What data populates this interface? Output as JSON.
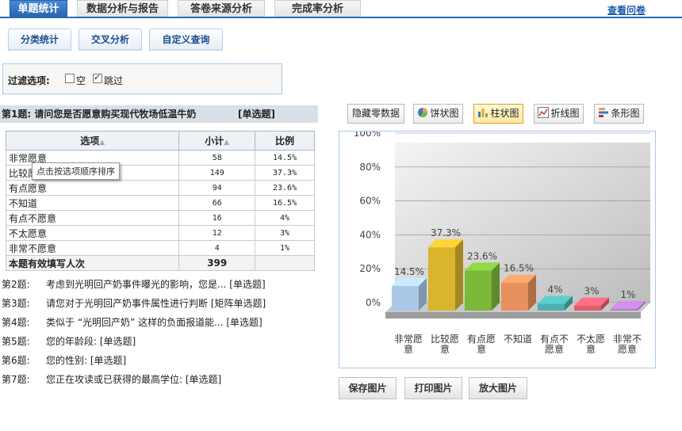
{
  "top_tabs": [
    {
      "label": "单题统计",
      "active": true
    },
    {
      "label": "数据分析与报告",
      "active": false
    },
    {
      "label": "答卷来源分析",
      "active": false
    },
    {
      "label": "完成率分析",
      "active": false
    }
  ],
  "view_link": "查看问卷",
  "sub_tabs": [
    "分类统计",
    "交叉分析",
    "自定义查询"
  ],
  "filter": {
    "label": "过滤选项:",
    "options": [
      {
        "label": "空",
        "checked": false
      },
      {
        "label": "跳过",
        "checked": true
      }
    ]
  },
  "question": {
    "title": "第1题:   请问您是否愿意购买现代牧场低温牛奶",
    "type": "[单选题]"
  },
  "table": {
    "headers": [
      "选项",
      "小计",
      "比例"
    ],
    "rows": [
      {
        "option": "非常愿意",
        "count": "58",
        "ratio": "14.5%"
      },
      {
        "option": "比较愿意",
        "count": "149",
        "ratio": "37.3%"
      },
      {
        "option": "有点愿意",
        "count": "94",
        "ratio": "23.6%"
      },
      {
        "option": "不知道",
        "count": "66",
        "ratio": "16.5%"
      },
      {
        "option": "有点不愿意",
        "count": "16",
        "ratio": "4%"
      },
      {
        "option": "不太愿意",
        "count": "12",
        "ratio": "3%"
      },
      {
        "option": "非常不愿意",
        "count": "4",
        "ratio": "1%"
      }
    ],
    "total_label": "本题有效填写人次",
    "total_value": "399",
    "tooltip": "点击按选项顺序排序"
  },
  "other_questions": [
    {
      "num": "第2题:",
      "text": "考虑到光明回产奶事件曝光的影响，您是...   [单选题]"
    },
    {
      "num": "第3题:",
      "text": "请您对于光明回产奶事件属性进行判断   [矩阵单选题]"
    },
    {
      "num": "第4题:",
      "text": "类似于 “光明回产奶” 这样的负面报道能...   [单选题]"
    },
    {
      "num": "第5题:",
      "text": "您的年龄段:   [单选题]"
    },
    {
      "num": "第6题:",
      "text": "您的性别:   [单选题]"
    },
    {
      "num": "第7题:",
      "text": "您正在攻读或已获得的最高学位:   [单选题]"
    }
  ],
  "chart_toolbar": [
    {
      "label": "隐藏零数据",
      "icon": "",
      "active": false
    },
    {
      "label": "饼状图",
      "icon": "pie-chart-icon",
      "active": false
    },
    {
      "label": "柱状图",
      "icon": "bar-chart-icon",
      "active": true
    },
    {
      "label": "折线图",
      "icon": "line-chart-icon",
      "active": false
    },
    {
      "label": "条形图",
      "icon": "horizontal-bar-chart-icon",
      "active": false
    }
  ],
  "chart_data": {
    "type": "bar",
    "categories": [
      "非常愿意",
      "比较愿意",
      "有点愿意",
      "不知道",
      "有点不愿意",
      "不太愿意",
      "非常不愿意"
    ],
    "category_lines": [
      [
        "非常愿",
        "意"
      ],
      [
        "比较愿",
        "意"
      ],
      [
        "有点愿",
        "意"
      ],
      [
        "不知道"
      ],
      [
        "有点不",
        "愿意"
      ],
      [
        "不太愿",
        "意"
      ],
      [
        "非常不",
        "愿意"
      ]
    ],
    "values": [
      14.5,
      37.3,
      23.6,
      16.5,
      4,
      3,
      1
    ],
    "labels": [
      "14.5%",
      "37.3%",
      "23.6%",
      "16.5%",
      "4%",
      "3%",
      "1%"
    ],
    "yticks": [
      "0%",
      "20%",
      "40%",
      "60%",
      "80%",
      "100%"
    ],
    "ylim": [
      0,
      100
    ],
    "colors": [
      "#a9c8e6",
      "#d9b42c",
      "#7cb83a",
      "#e8905e",
      "#4bb0b0",
      "#e06070",
      "#b47ac8"
    ]
  },
  "actions": [
    "保存图片",
    "打印图片",
    "放大图片"
  ]
}
